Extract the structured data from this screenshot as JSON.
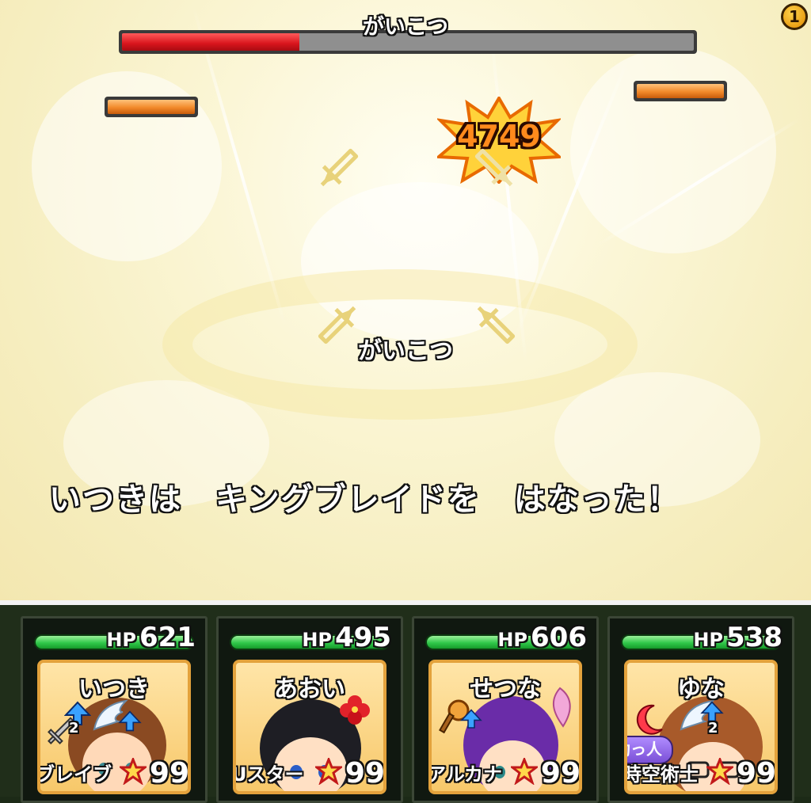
{
  "battle": {
    "boss_name": "がいこつ",
    "boss_hp_fraction": 0.31,
    "target_name": "がいこつ",
    "damage": "4749",
    "message": "いつきは　キングブレイドを　はなった！",
    "turn": "1",
    "enemy_hp_fractions": [
      1.0,
      1.0
    ]
  },
  "party": [
    {
      "hp_label": "HP",
      "hp": "621",
      "name": "いつき",
      "job": "ブレイブ",
      "level": "99",
      "buff_count": "2",
      "hair_color": "#8a4a22"
    },
    {
      "hp_label": "HP",
      "hp": "495",
      "name": "あおい",
      "job": "Uスター",
      "level": "99",
      "hair_color": "#1e1e24"
    },
    {
      "hp_label": "HP",
      "hp": "606",
      "name": "せつな",
      "job": "アルカナ",
      "level": "99",
      "hair_color": "#6a2ca8"
    },
    {
      "hp_label": "HP",
      "hp": "538",
      "name": "ゆな",
      "job": "時空術士",
      "level": "99",
      "buff_count": "2",
      "helper_label": "助っ人",
      "hair_color": "#a85a2a"
    }
  ],
  "colors": {
    "boss_hp": "#d8141c",
    "enemy_hp": "#f28a2a",
    "party_hp": "#31c84a",
    "panel_bg": "#202e1a",
    "portrait_frame": "#e3a23c"
  }
}
